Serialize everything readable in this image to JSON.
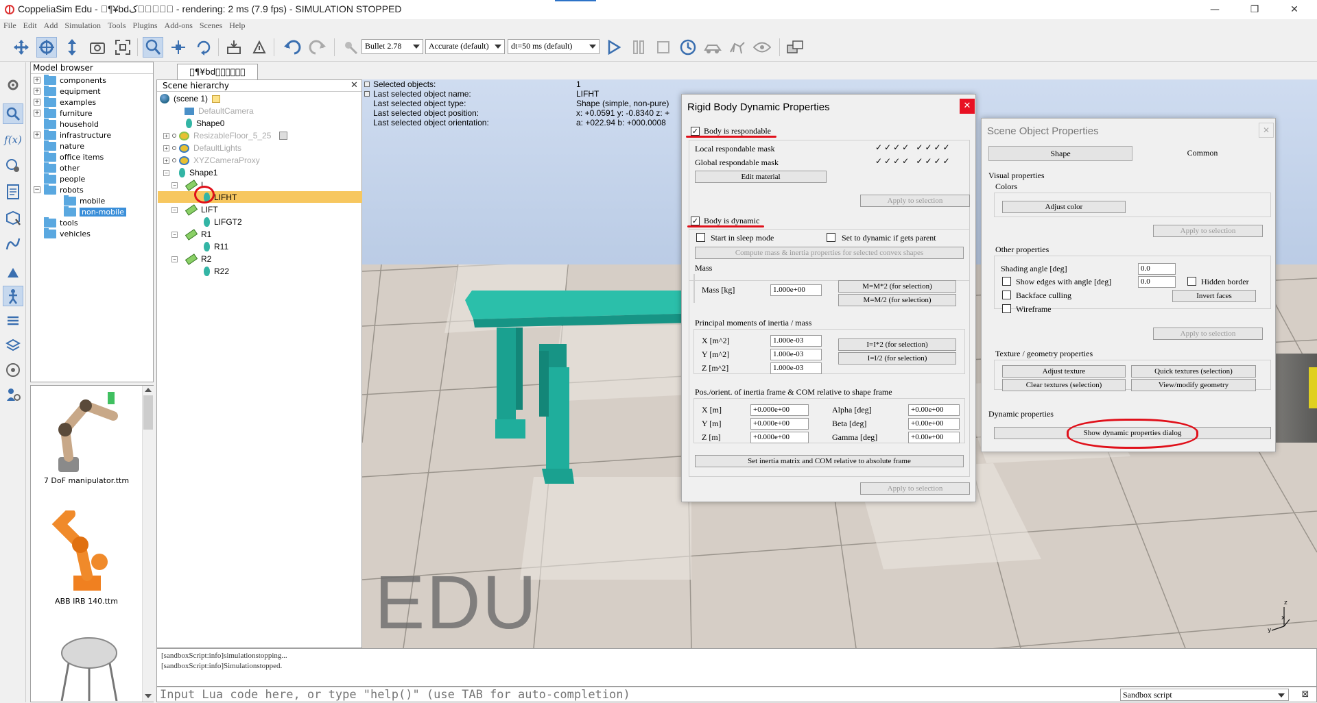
{
  "window": {
    "title": "CoppeliaSim Edu - \u0000¶¥bd\u0000\u0000ک\u0000\u0000\u0000 - rendering: 2 ms (7.9 fps) - SIMULATION STOPPED",
    "minimize": "—",
    "restore": "❐",
    "close": "✕"
  },
  "menu": [
    "File",
    "Edit",
    "Add",
    "Simulation",
    "Tools",
    "Plugins",
    "Add-ons",
    "Scenes",
    "Help"
  ],
  "toolbar": {
    "engine": "Bullet 2.78",
    "accuracy": "Accurate (default)",
    "timestep": "dt=50 ms (default)"
  },
  "model_browser": {
    "header": "Model browser",
    "items": [
      {
        "label": "components",
        "expandable": true
      },
      {
        "label": "equipment",
        "expandable": true
      },
      {
        "label": "examples",
        "expandable": true
      },
      {
        "label": "furniture",
        "expandable": true
      },
      {
        "label": "household",
        "expandable": false
      },
      {
        "label": "infrastructure",
        "expandable": true
      },
      {
        "label": "nature",
        "expandable": false
      },
      {
        "label": "office items",
        "expandable": false
      },
      {
        "label": "other",
        "expandable": false
      },
      {
        "label": "people",
        "expandable": false
      },
      {
        "label": "robots",
        "expandable": true
      },
      {
        "label": "mobile",
        "expandable": false
      },
      {
        "label": "non-mobile",
        "expandable": false
      },
      {
        "label": "tools",
        "expandable": false
      },
      {
        "label": "vehicles",
        "expandable": false
      }
    ],
    "thumbnails": [
      "7 DoF manipulator.ttm",
      "ABB IRB 140.ttm"
    ]
  },
  "scene_tab": "\u0000¶¥bd\u0000\u0000\u0000\u0000\u0000\u0000",
  "hierarchy": {
    "header": "Scene hierarchy",
    "close": "✕",
    "items": {
      "scene": "(scene 1)",
      "camera": "DefaultCamera",
      "shape0": "Shape0",
      "floor": "ResizableFloor_5_25",
      "lights": "DefaultLights",
      "proxy": "XYZCameraProxy",
      "shape1": "Shape1",
      "joint1": "L",
      "lifht": "LIFHT",
      "lift": "LIFT",
      "lifgt2": "LIFGT2",
      "r1": "R1",
      "r11": "R11",
      "r2": "R2",
      "r22": "R22"
    }
  },
  "info": {
    "rows": [
      {
        "label": "Selected objects:",
        "value": "1"
      },
      {
        "label": "Last selected object name:",
        "value": "LIFHT"
      },
      {
        "label": "Last selected object type:",
        "value": "Shape (simple, non-pure)"
      },
      {
        "label": "Last selected object position:",
        "value": "x: +0.0591    y: -0.8340    z: +"
      },
      {
        "label": "Last selected object orientation:",
        "value": "a: +022.94    b: +000.0008"
      }
    ]
  },
  "watermark": "EDU",
  "rigid_body_dialog": {
    "title": "Rigid Body Dynamic Properties",
    "close": "✕",
    "respondable_label": "Body is respondable",
    "local_mask": "Local respondable mask",
    "global_mask": "Global respondable mask",
    "mask_marks": "✓✓✓✓  ✓✓✓✓",
    "edit_material": "Edit material",
    "apply": "Apply to selection",
    "dynamic_label": "Body is dynamic",
    "sleep_mode": "Start in sleep mode",
    "dynamic_if_parent": "Set to dynamic if gets parent",
    "compute_mass": "Compute mass & inertia properties for selected convex shapes",
    "mass_group": "Mass",
    "mass_label": "Mass [kg]",
    "mass_value": "1.000e+00",
    "mass_x2": "M=M*2  (for selection)",
    "mass_div2": "M=M/2  (for selection)",
    "inertia_group": "Principal moments of inertia / mass",
    "ix": "X [m^2]",
    "iy": "Y [m^2]",
    "iz": "Z [m^2]",
    "ix_val": "1.000e-03",
    "iy_val": "1.000e-03",
    "iz_val": "1.000e-03",
    "i_x2": "I=I*2  (for selection)",
    "i_div2": "I=I/2  (for selection)",
    "frame_group": "Pos./orient. of inertia frame & COM relative to shape frame",
    "px": "X [m]",
    "py": "Y [m]",
    "pz": "Z [m]",
    "px_val": "+0.000e+00",
    "py_val": "+0.000e+00",
    "pz_val": "+0.000e+00",
    "alpha": "Alpha [deg]",
    "beta": "Beta [deg]",
    "gamma": "Gamma [deg]",
    "alpha_val": "+0.00e+00",
    "beta_val": "+0.00e+00",
    "gamma_val": "+0.00e+00",
    "set_inertia": "Set inertia matrix and COM relative to absolute frame"
  },
  "scene_object_dialog": {
    "title": "Scene Object Properties",
    "close": "✕",
    "tab_shape": "Shape",
    "tab_common": "Common",
    "visual": "Visual properties",
    "colors": "Colors",
    "adjust_color": "Adjust color",
    "apply": "Apply to selection",
    "other": "Other properties",
    "shading": "Shading angle [deg]",
    "shading_val": "0.0",
    "show_edges": "Show edges with angle [deg]",
    "edges_val": "0.0",
    "hidden_border": "Hidden border",
    "backface": "Backface culling",
    "invert_faces": "Invert faces",
    "wireframe": "Wireframe",
    "texture_group": "Texture / geometry properties",
    "adjust_texture": "Adjust texture",
    "quick_textures": "Quick textures (selection)",
    "clear_textures": "Clear textures (selection)",
    "view_geometry": "View/modify geometry",
    "dynamic_props": "Dynamic properties",
    "show_dynamic": "Show dynamic properties dialog"
  },
  "console": {
    "lines": [
      "[sandboxScript:info]simulationstopping...",
      "[sandboxScript:info]Simulationstopped."
    ]
  },
  "cmd": {
    "placeholder": "Input Lua code here, or type \"help()\" (use TAB for auto-completion)",
    "script": "Sandbox script"
  },
  "colors": {
    "annotation": "#e0101a",
    "selection": "#f7c75f",
    "teal": "#1aa89a"
  }
}
